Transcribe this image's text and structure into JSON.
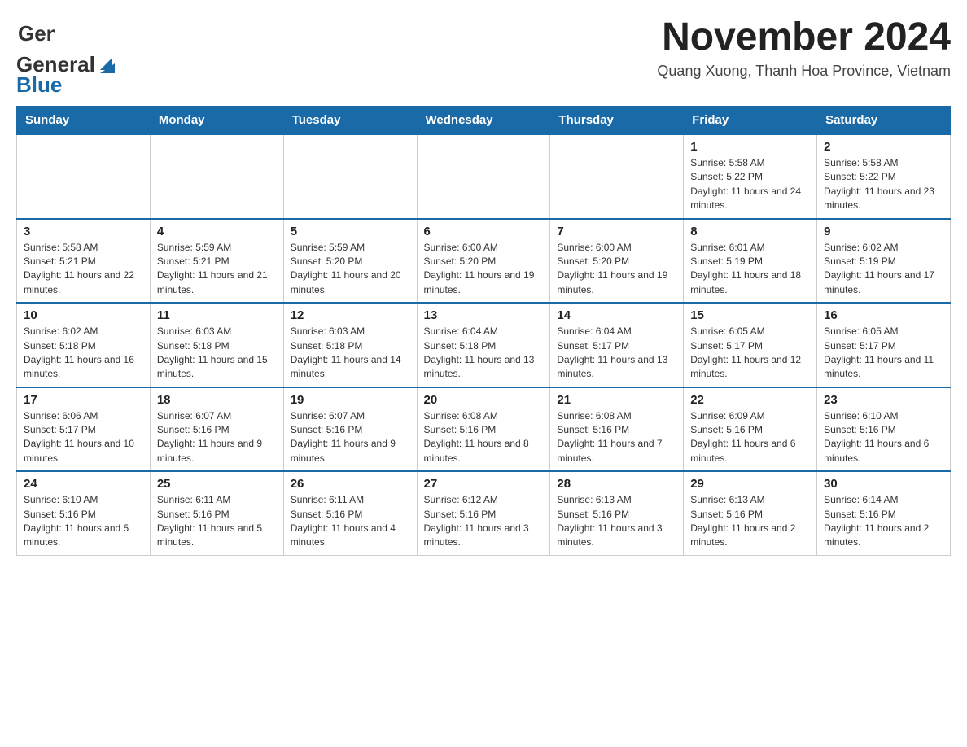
{
  "logo": {
    "general": "General",
    "blue": "Blue",
    "arrow_desc": "logo arrow"
  },
  "header": {
    "title": "November 2024",
    "subtitle": "Quang Xuong, Thanh Hoa Province, Vietnam"
  },
  "weekdays": [
    "Sunday",
    "Monday",
    "Tuesday",
    "Wednesday",
    "Thursday",
    "Friday",
    "Saturday"
  ],
  "weeks": [
    [
      {
        "day": "",
        "info": ""
      },
      {
        "day": "",
        "info": ""
      },
      {
        "day": "",
        "info": ""
      },
      {
        "day": "",
        "info": ""
      },
      {
        "day": "",
        "info": ""
      },
      {
        "day": "1",
        "info": "Sunrise: 5:58 AM\nSunset: 5:22 PM\nDaylight: 11 hours and 24 minutes."
      },
      {
        "day": "2",
        "info": "Sunrise: 5:58 AM\nSunset: 5:22 PM\nDaylight: 11 hours and 23 minutes."
      }
    ],
    [
      {
        "day": "3",
        "info": "Sunrise: 5:58 AM\nSunset: 5:21 PM\nDaylight: 11 hours and 22 minutes."
      },
      {
        "day": "4",
        "info": "Sunrise: 5:59 AM\nSunset: 5:21 PM\nDaylight: 11 hours and 21 minutes."
      },
      {
        "day": "5",
        "info": "Sunrise: 5:59 AM\nSunset: 5:20 PM\nDaylight: 11 hours and 20 minutes."
      },
      {
        "day": "6",
        "info": "Sunrise: 6:00 AM\nSunset: 5:20 PM\nDaylight: 11 hours and 19 minutes."
      },
      {
        "day": "7",
        "info": "Sunrise: 6:00 AM\nSunset: 5:20 PM\nDaylight: 11 hours and 19 minutes."
      },
      {
        "day": "8",
        "info": "Sunrise: 6:01 AM\nSunset: 5:19 PM\nDaylight: 11 hours and 18 minutes."
      },
      {
        "day": "9",
        "info": "Sunrise: 6:02 AM\nSunset: 5:19 PM\nDaylight: 11 hours and 17 minutes."
      }
    ],
    [
      {
        "day": "10",
        "info": "Sunrise: 6:02 AM\nSunset: 5:18 PM\nDaylight: 11 hours and 16 minutes."
      },
      {
        "day": "11",
        "info": "Sunrise: 6:03 AM\nSunset: 5:18 PM\nDaylight: 11 hours and 15 minutes."
      },
      {
        "day": "12",
        "info": "Sunrise: 6:03 AM\nSunset: 5:18 PM\nDaylight: 11 hours and 14 minutes."
      },
      {
        "day": "13",
        "info": "Sunrise: 6:04 AM\nSunset: 5:18 PM\nDaylight: 11 hours and 13 minutes."
      },
      {
        "day": "14",
        "info": "Sunrise: 6:04 AM\nSunset: 5:17 PM\nDaylight: 11 hours and 13 minutes."
      },
      {
        "day": "15",
        "info": "Sunrise: 6:05 AM\nSunset: 5:17 PM\nDaylight: 11 hours and 12 minutes."
      },
      {
        "day": "16",
        "info": "Sunrise: 6:05 AM\nSunset: 5:17 PM\nDaylight: 11 hours and 11 minutes."
      }
    ],
    [
      {
        "day": "17",
        "info": "Sunrise: 6:06 AM\nSunset: 5:17 PM\nDaylight: 11 hours and 10 minutes."
      },
      {
        "day": "18",
        "info": "Sunrise: 6:07 AM\nSunset: 5:16 PM\nDaylight: 11 hours and 9 minutes."
      },
      {
        "day": "19",
        "info": "Sunrise: 6:07 AM\nSunset: 5:16 PM\nDaylight: 11 hours and 9 minutes."
      },
      {
        "day": "20",
        "info": "Sunrise: 6:08 AM\nSunset: 5:16 PM\nDaylight: 11 hours and 8 minutes."
      },
      {
        "day": "21",
        "info": "Sunrise: 6:08 AM\nSunset: 5:16 PM\nDaylight: 11 hours and 7 minutes."
      },
      {
        "day": "22",
        "info": "Sunrise: 6:09 AM\nSunset: 5:16 PM\nDaylight: 11 hours and 6 minutes."
      },
      {
        "day": "23",
        "info": "Sunrise: 6:10 AM\nSunset: 5:16 PM\nDaylight: 11 hours and 6 minutes."
      }
    ],
    [
      {
        "day": "24",
        "info": "Sunrise: 6:10 AM\nSunset: 5:16 PM\nDaylight: 11 hours and 5 minutes."
      },
      {
        "day": "25",
        "info": "Sunrise: 6:11 AM\nSunset: 5:16 PM\nDaylight: 11 hours and 5 minutes."
      },
      {
        "day": "26",
        "info": "Sunrise: 6:11 AM\nSunset: 5:16 PM\nDaylight: 11 hours and 4 minutes."
      },
      {
        "day": "27",
        "info": "Sunrise: 6:12 AM\nSunset: 5:16 PM\nDaylight: 11 hours and 3 minutes."
      },
      {
        "day": "28",
        "info": "Sunrise: 6:13 AM\nSunset: 5:16 PM\nDaylight: 11 hours and 3 minutes."
      },
      {
        "day": "29",
        "info": "Sunrise: 6:13 AM\nSunset: 5:16 PM\nDaylight: 11 hours and 2 minutes."
      },
      {
        "day": "30",
        "info": "Sunrise: 6:14 AM\nSunset: 5:16 PM\nDaylight: 11 hours and 2 minutes."
      }
    ]
  ]
}
